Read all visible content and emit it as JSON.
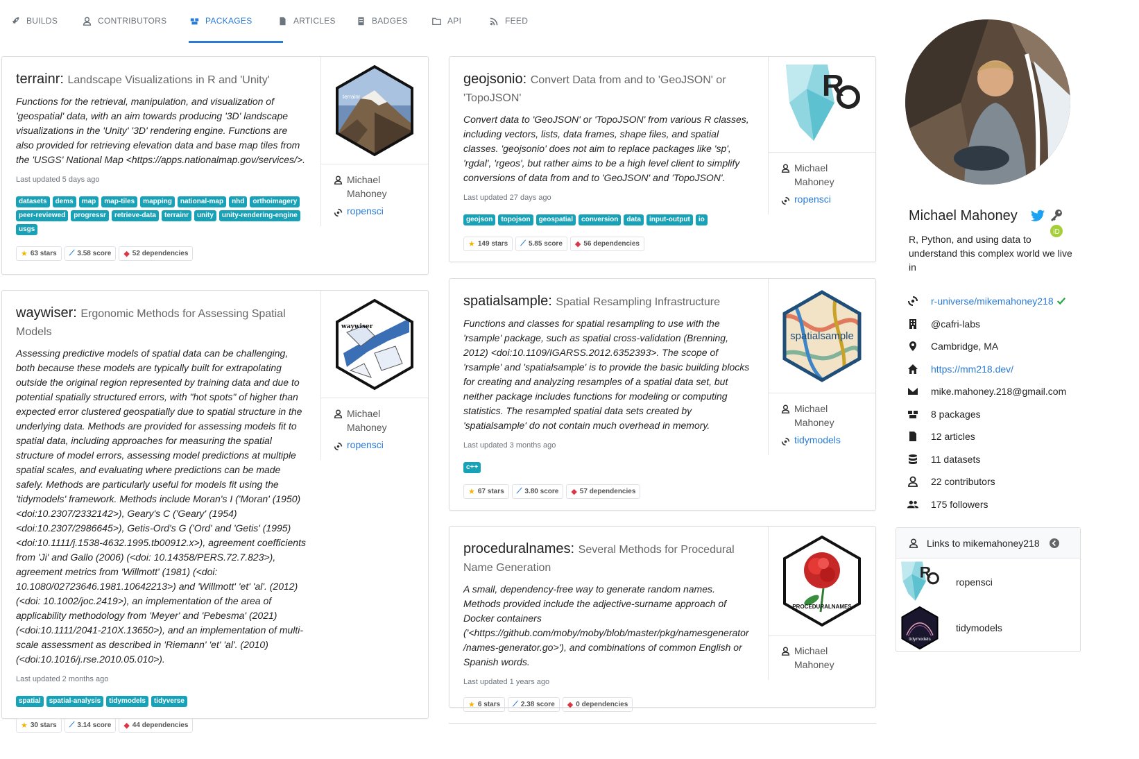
{
  "nav": {
    "tabs": [
      {
        "label": "BUILDS",
        "icon": "rocket-icon"
      },
      {
        "label": "CONTRIBUTORS",
        "icon": "user-icon"
      },
      {
        "label": "PACKAGES",
        "icon": "boxes-icon",
        "active": true
      },
      {
        "label": "ARTICLES",
        "icon": "file-icon"
      },
      {
        "label": "BADGES",
        "icon": "badge-icon"
      },
      {
        "label": "API",
        "icon": "folder-icon"
      },
      {
        "label": "FEED",
        "icon": "rss-icon"
      }
    ]
  },
  "packages": [
    {
      "name": "terrainr:",
      "tagline": "Landscape Visualizations in R and 'Unity'",
      "description": "Functions for the retrieval, manipulation, and visualization of 'geospatial' data, with an aim towards producing '3D' landscape visualizations in the 'Unity' '3D' rendering engine. Functions are also provided for retrieving elevation data and base map tiles from the 'USGS' National Map <https://apps.nationalmap.gov/services/>.",
      "updated": "Last updated 5 days ago",
      "topics": [
        "datasets",
        "dems",
        "map",
        "map-tiles",
        "mapping",
        "national-map",
        "nhd",
        "orthoimagery",
        "peer-reviewed",
        "progressr",
        "retrieve-data",
        "terrainr",
        "unity",
        "unity-rendering-engine",
        "usgs"
      ],
      "stars": "63 stars",
      "score": "3.58 score",
      "deps": "52 dependencies",
      "maintainer": "Michael Mahoney",
      "org": "ropensci",
      "logo_text": "terrainr"
    },
    {
      "name": "waywiser:",
      "tagline": "Ergonomic Methods for Assessing Spatial Models",
      "description": "Assessing predictive models of spatial data can be challenging, both because these models are typically built for extrapolating outside the original region represented by training data and due to potential spatially structured errors, with \"hot spots\" of higher than expected error clustered geospatially due to spatial structure in the underlying data. Methods are provided for assessing models fit to spatial data, including approaches for measuring the spatial structure of model errors, assessing model predictions at multiple spatial scales, and evaluating where predictions can be made safely. Methods are particularly useful for models fit using the 'tidymodels' framework. Methods include Moran's I ('Moran' (1950) <doi:10.2307/2332142>), Geary's C ('Geary' (1954) <doi:10.2307/2986645>), Getis-Ord's G ('Ord' and 'Getis' (1995) <doi:10.1111/j.1538-4632.1995.tb00912.x>), agreement coefficients from 'Ji' and Gallo (2006) (<doi: 10.14358/PERS.72.7.823>), agreement metrics from 'Willmott' (1981) (<doi: 10.1080/02723646.1981.10642213>) and 'Willmott' 'et' 'al'. (2012) (<doi: 10.1002/joc.2419>), an implementation of the area of applicability methodology from 'Meyer' and 'Pebesma' (2021) (<doi:10.1111/2041-210X.13650>), and an implementation of multi-scale assessment as described in 'Riemann' 'et' 'al'. (2010) (<doi:10.1016/j.rse.2010.05.010>).",
      "updated": "Last updated 2 months ago",
      "topics": [
        "spatial",
        "spatial-analysis",
        "tidymodels",
        "tidyverse"
      ],
      "stars": "30 stars",
      "score": "3.14 score",
      "deps": "44 dependencies",
      "maintainer": "Michael Mahoney",
      "org": "ropensci",
      "logo_text": "waywiser"
    },
    {
      "name": "geojsonio:",
      "tagline": "Convert Data from and to 'GeoJSON' or 'TopoJSON'",
      "description": "Convert data to 'GeoJSON' or 'TopoJSON' from various R classes, including vectors, lists, data frames, shape files, and spatial classes. 'geojsonio' does not aim to replace packages like 'sp', 'rgdal', 'rgeos', but rather aims to be a high level client to simplify conversions of data from and to 'GeoJSON' and 'TopoJSON'.",
      "updated": "Last updated 27 days ago",
      "topics": [
        "geojson",
        "topojson",
        "geospatial",
        "conversion",
        "data",
        "input-output",
        "io"
      ],
      "stars": "149 stars",
      "score": "5.85 score",
      "deps": "56 dependencies",
      "maintainer": "Michael Mahoney",
      "org": "ropensci"
    },
    {
      "name": "spatialsample:",
      "tagline": "Spatial Resampling Infrastructure",
      "description": "Functions and classes for spatial resampling to use with the 'rsample' package, such as spatial cross-validation (Brenning, 2012) <doi:10.1109/IGARSS.2012.6352393>. The scope of 'rsample' and 'spatialsample' is to provide the basic building blocks for creating and analyzing resamples of a spatial data set, but neither package includes functions for modeling or computing statistics. The resampled spatial data sets created by 'spatialsample' do not contain much overhead in memory.",
      "updated": "Last updated 3 months ago",
      "topics": [
        "c++"
      ],
      "stars": "67 stars",
      "score": "3.80 score",
      "deps": "57 dependencies",
      "maintainer": "Michael Mahoney",
      "org": "tidymodels",
      "logo_text": "spatialsample"
    },
    {
      "name": "proceduralnames:",
      "tagline": "Several Methods for Procedural Name Generation",
      "description": "A small, dependency-free way to generate random names. Methods provided include the adjective-surname approach of Docker containers ('<https://github.com/moby/moby/blob/master/pkg/namesgenerator /names-generator.go>'), and combinations of common English or Spanish words.",
      "updated": "Last updated 1 years ago",
      "stars": "6 stars",
      "score": "2.38 score",
      "deps": "0 dependencies",
      "maintainer": "Michael Mahoney",
      "logo_text": "PROCEDURALNAMES"
    }
  ],
  "profile": {
    "name": "Michael Mahoney",
    "bio": "R, Python, and using data to understand this complex world we live in",
    "info": {
      "universe": "r-universe/mikemahoney218",
      "company": "@cafri-labs",
      "location": "Cambridge, MA",
      "website": "https://mm218.dev/",
      "email": "mike.mahoney.218@gmail.com",
      "packages": "8 packages",
      "articles": "12 articles",
      "datasets": "11 datasets",
      "contributors": "22 contributors",
      "followers": "175 followers"
    },
    "links_title": "Links to mikemahoney218",
    "links": [
      {
        "name": "ropensci"
      },
      {
        "name": "tidymodels",
        "logo_text": "tidymodels"
      }
    ]
  },
  "colors": {
    "accent": "#2a7bd6",
    "topic": "#17a2b8",
    "verified": "#28a745",
    "twitter": "#1da1f2",
    "orcid": "#a6ce39"
  }
}
